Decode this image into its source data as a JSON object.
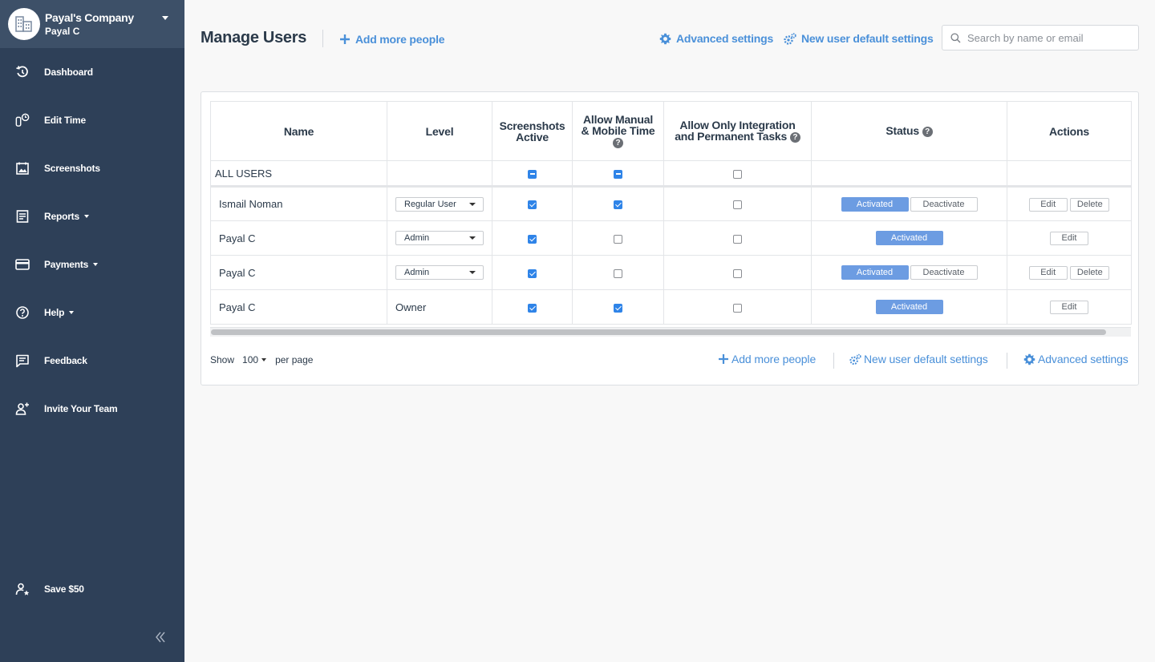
{
  "sidebar": {
    "company_name": "Payal's Company",
    "company_user": "Payal C",
    "items": [
      {
        "label": "Dashboard",
        "icon": "history-icon"
      },
      {
        "label": "Edit Time",
        "icon": "edit-time-icon"
      },
      {
        "label": "Screenshots",
        "icon": "calendar-image-icon"
      },
      {
        "label": "Reports",
        "icon": "report-icon"
      },
      {
        "label": "Payments",
        "icon": "credit-card-icon"
      },
      {
        "label": "Help",
        "icon": "question-circle-icon"
      },
      {
        "label": "Feedback",
        "icon": "feedback-icon"
      },
      {
        "label": "Invite Your Team",
        "icon": "add-user-icon"
      }
    ],
    "save_label": "Save $50"
  },
  "header": {
    "title": "Manage Users",
    "add_people": "Add more people",
    "advanced_settings": "Advanced settings",
    "new_user_defaults": "New user default settings",
    "search_placeholder": "Search by name or email"
  },
  "table": {
    "headers": {
      "name": "Name",
      "level": "Level",
      "screenshots_1": "Screenshots",
      "screenshots_2": "Active",
      "manual_1": "Allow Manual",
      "manual_2": "& Mobile Time",
      "integration_1": "Allow Only Integration",
      "integration_2": "and Permanent Tasks",
      "status": "Status",
      "actions": "Actions"
    },
    "all_users_label": "ALL USERS",
    "rows": [
      {
        "name": "Ismail Noman",
        "level": "Regular User",
        "status": "Activated",
        "deactivate": "Deactivate",
        "edit": "Edit",
        "delete": "Delete"
      },
      {
        "name": "Payal C",
        "level": "Admin",
        "status": "Activated",
        "edit": "Edit"
      },
      {
        "name": "Payal C",
        "level": "Admin",
        "status": "Activated",
        "deactivate": "Deactivate",
        "edit": "Edit",
        "delete": "Delete"
      },
      {
        "name": "Payal C",
        "level": "Owner",
        "status": "Activated",
        "edit": "Edit"
      }
    ]
  },
  "footer": {
    "show": "Show",
    "per_page_value": "100",
    "per_page": "per page",
    "add_people": "Add more people",
    "new_user_defaults": "New user default settings",
    "advanced_settings": "Advanced settings"
  },
  "colors": {
    "sidebar_bg": "#2e4058",
    "accent": "#4a90d9",
    "checkbox": "#2f84e8",
    "activated": "#6c9ce2"
  }
}
